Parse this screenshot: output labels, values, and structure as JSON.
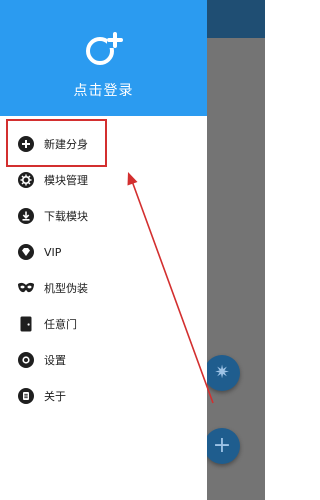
{
  "header": {
    "login_label": "点击登录"
  },
  "menu": {
    "items": [
      {
        "label": "新建分身",
        "icon": "plus-circle-icon"
      },
      {
        "label": "模块管理",
        "icon": "gear-icon"
      },
      {
        "label": "下载模块",
        "icon": "download-icon"
      },
      {
        "label": "VIP",
        "icon": "vip-diamond-icon"
      },
      {
        "label": "机型伪装",
        "icon": "mask-icon"
      },
      {
        "label": "任意门",
        "icon": "door-icon"
      },
      {
        "label": "设置",
        "icon": "settings-icon"
      },
      {
        "label": "关于",
        "icon": "about-icon"
      }
    ]
  },
  "colors": {
    "header_bg": "#2b9bf0",
    "highlight": "#d32f2f",
    "fab": "#1f5d8e"
  }
}
